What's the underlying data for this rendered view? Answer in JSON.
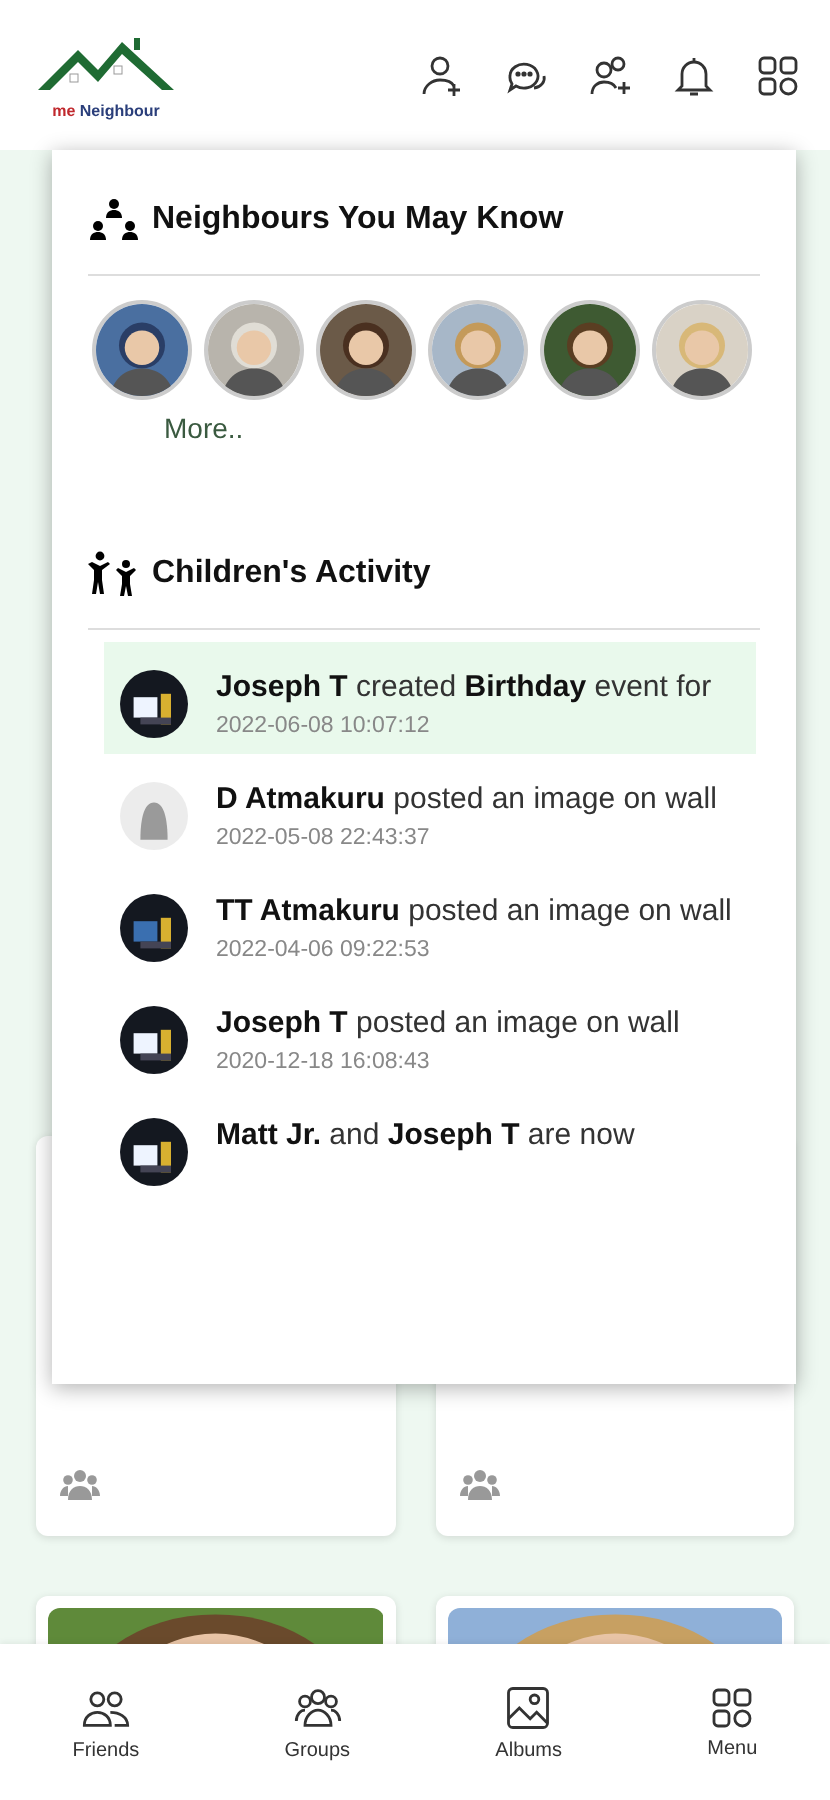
{
  "header": {
    "logo": {
      "prefix": "me",
      "name": "Neighbour"
    }
  },
  "dropdown": {
    "neighbours": {
      "title": "Neighbours You May Know",
      "people": [
        {
          "kind": "picture"
        },
        {
          "kind": "picture"
        },
        {
          "kind": "picture"
        },
        {
          "kind": "picture"
        },
        {
          "kind": "picture"
        },
        {
          "kind": "picture"
        }
      ],
      "more": "More.."
    },
    "activity": {
      "title": "Children's Activity",
      "items": [
        {
          "text": "**Joseph T** created **Birthday** event for",
          "time": "2022-06-08 10:07:12",
          "selected": true
        },
        {
          "text": "**D Atmakuru** posted an image on wall",
          "time": "2022-05-08 22:43:37",
          "selected": false,
          "kind": "blank"
        },
        {
          "text": "**TT Atmakuru** posted an image on wall",
          "time": "2022-04-06 09:22:53",
          "selected": false
        },
        {
          "text": "**Joseph T** posted an image on wall",
          "time": "2020-12-18 16:08:43",
          "selected": false
        },
        {
          "text": "**Matt Jr.** and **Joseph T** are now",
          "selected": false
        }
      ]
    }
  },
  "cards": [
    {
      "kind": "group"
    },
    {
      "kind": "group"
    },
    {
      "kind": "picture"
    },
    {
      "kind": "picture"
    }
  ],
  "bottom_nav": [
    {
      "label": "Friends",
      "kind": "friends"
    },
    {
      "label": "Groups",
      "kind": "groups"
    },
    {
      "label": "Albums",
      "kind": "albums"
    },
    {
      "label": "Menu",
      "kind": "menu"
    }
  ]
}
